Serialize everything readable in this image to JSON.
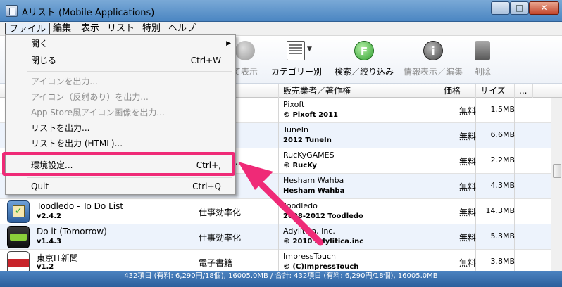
{
  "window": {
    "title": "Aリスト (Mobile Applications)",
    "min": "—",
    "max": "□",
    "close": "✕"
  },
  "menubar": [
    "ファイル",
    "編集",
    "表示",
    "リスト",
    "特別",
    "ヘルプ"
  ],
  "toolbar": {
    "display": "て表示",
    "category": "カテゴリー別",
    "search": "検索／絞り込み",
    "info": "情報表示／編集",
    "delete": "削除"
  },
  "columns": {
    "category": "ー",
    "seller": "販売業者／著作権",
    "price": "価格",
    "size": "サイズ",
    "more": "..."
  },
  "rows": [
    {
      "name": "",
      "version": "",
      "category": "",
      "seller": "Pixoft",
      "copyright": "© Pixoft 2011",
      "price": "無料",
      "size": "1.5MB"
    },
    {
      "name": "",
      "version": "",
      "category": "ック",
      "seller": "TuneIn",
      "copyright": "2012 TuneIn",
      "price": "無料",
      "size": "6.6MB"
    },
    {
      "name": "",
      "version": "",
      "category": "ード,カー...",
      "seller": "RucKyGAMES",
      "copyright": "© RucKy",
      "price": "無料",
      "size": "2.2MB"
    },
    {
      "name": "",
      "version": "",
      "category": "化",
      "seller": "Hesham Wahba",
      "copyright": "Hesham Wahba",
      "price": "無料",
      "size": "4.3MB"
    },
    {
      "name": "Toodledo - To Do List",
      "version": "v2.4.2",
      "category": "仕事効率化",
      "seller": "Toodledo",
      "copyright": "2008-2012 Toodledo",
      "price": "無料",
      "size": "14.3MB"
    },
    {
      "name": "Do it (Tomorrow)",
      "version": "v1.4.3",
      "category": "仕事効率化",
      "seller": "Adylitica, Inc.",
      "copyright": "© 2010 Adylitica.inc",
      "price": "無料",
      "size": "5.3MB"
    },
    {
      "name": "東京IT新聞",
      "version": "v1.2",
      "category": "電子書籍",
      "seller": "ImpressTouch",
      "copyright": "© (C)ImpressTouch",
      "price": "無料",
      "size": "3.8MB"
    }
  ],
  "status": "432項目 (有料: 6,290円/18個), 16005.0MB / 合計: 432項目 (有料: 6,290円/18個), 16005.0MB",
  "file_menu": {
    "open": "開く",
    "close": "閉じる",
    "close_shortcut": "Ctrl+W",
    "export_icon": "アイコンを出力...",
    "export_icon_reflect": "アイコン（反射あり）を出力...",
    "export_appstore_icon": "App Store風アイコン画像を出力...",
    "export_list": "リストを出力...",
    "export_list_html": "リストを出力 (HTML)...",
    "preferences": "環境設定...",
    "preferences_shortcut": "Ctrl+,",
    "quit": "Quit",
    "quit_shortcut": "Ctrl+Q"
  },
  "colors": {
    "highlight": "#ef2a77",
    "statusbar": "#2c5f9c",
    "row_alt": "#edf3fc"
  }
}
